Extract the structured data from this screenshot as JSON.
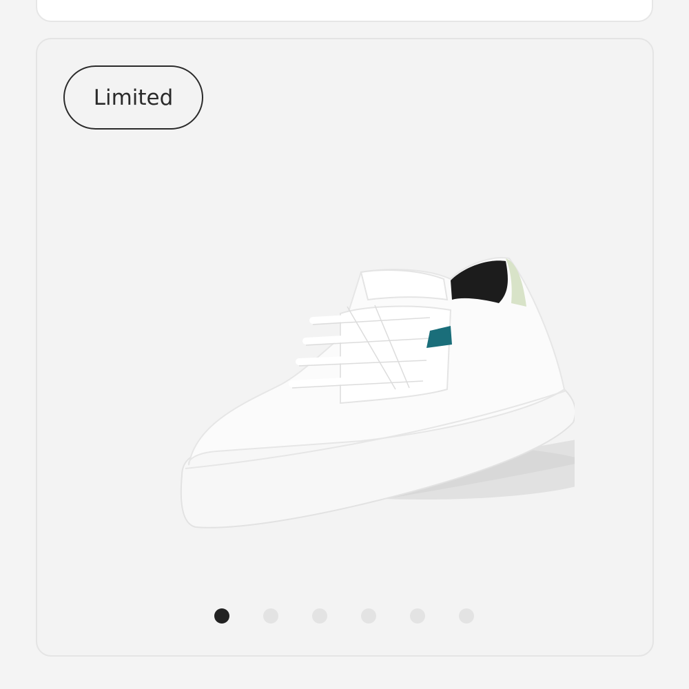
{
  "product": {
    "badge_label": "Limited",
    "image_icon": "white-knit-sneaker",
    "carousel": {
      "total_slides": 6,
      "active_index": 0
    }
  },
  "colors": {
    "badge_border": "#2a2a2a",
    "dot_active": "#222222",
    "dot_inactive": "#e3e3e3",
    "accent_tab": "#1a6e7a"
  }
}
